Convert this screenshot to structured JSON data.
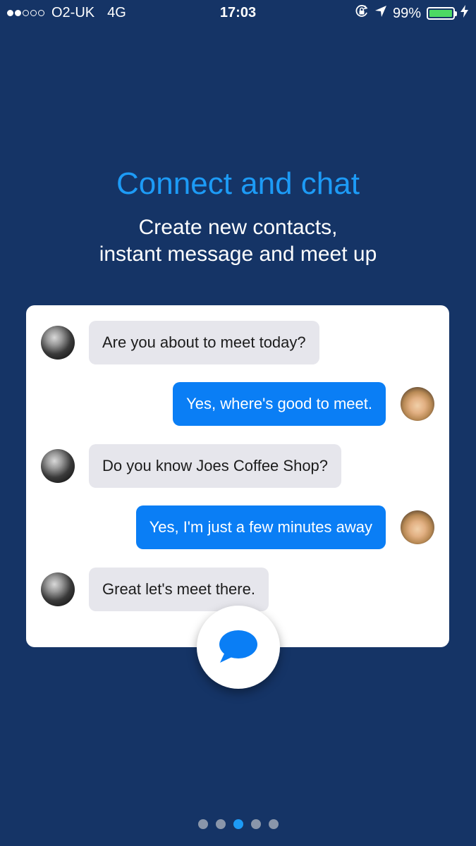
{
  "status_bar": {
    "signal_filled": 2,
    "signal_total": 5,
    "carrier": "O2-UK",
    "network": "4G",
    "time": "17:03",
    "battery_percent": "99%",
    "battery_level": 0.99,
    "icons": [
      "orientation-lock-icon",
      "location-arrow-icon",
      "battery-icon",
      "charging-bolt-icon"
    ]
  },
  "onboarding": {
    "title": "Connect and chat",
    "subtitle_line1": "Create new contacts,",
    "subtitle_line2": "instant message and meet up"
  },
  "chat": {
    "messages": [
      {
        "text": "Are you about to meet today?",
        "direction": "received"
      },
      {
        "text": "Yes, where's good to meet.",
        "direction": "sent"
      },
      {
        "text": "Do you know Joes Coffee Shop?",
        "direction": "received"
      },
      {
        "text": "Yes, I'm just a few minutes away",
        "direction": "sent"
      },
      {
        "text": "Great let's meet there.",
        "direction": "received"
      }
    ],
    "fab_icon": "chat-bubble-icon"
  },
  "pagination": {
    "total_pages": 5,
    "current_page": 3
  },
  "colors": {
    "background": "#153466",
    "title": "#1d9bf6",
    "sent_bubble": "#0a7ef5",
    "received_bubble": "#e6e6ec",
    "active_dot": "#1d9bf6",
    "inactive_dot": "#8a96aa"
  }
}
